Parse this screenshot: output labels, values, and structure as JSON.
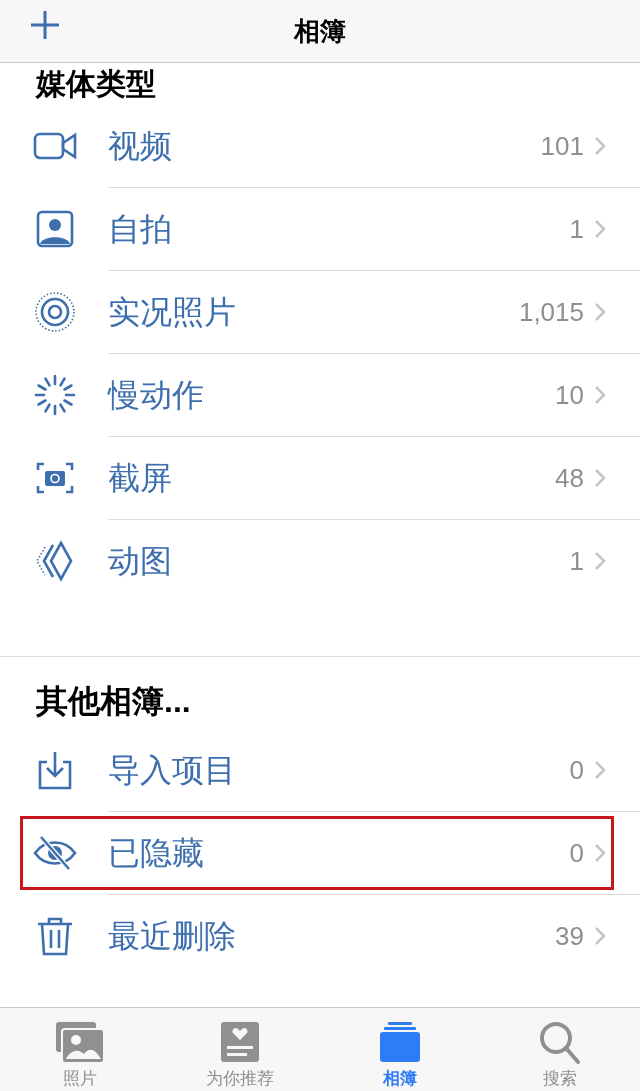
{
  "nav_bar": {
    "title": "相簿"
  },
  "media_types": {
    "title": "媒体类型",
    "items": [
      {
        "kind": "video",
        "label": "视频",
        "count": "101",
        "highlighted": false
      },
      {
        "kind": "selfie",
        "label": "自拍",
        "count": "1",
        "highlighted": false
      },
      {
        "kind": "live",
        "label": "实况照片",
        "count": "1,015",
        "highlighted": false
      },
      {
        "kind": "slomo",
        "label": "慢动作",
        "count": "10",
        "highlighted": false
      },
      {
        "kind": "screenshot",
        "label": "截屏",
        "count": "48",
        "highlighted": false
      },
      {
        "kind": "animated",
        "label": "动图",
        "count": "1",
        "highlighted": false
      }
    ]
  },
  "other_albums": {
    "title": "其他相簿...",
    "items": [
      {
        "kind": "import",
        "label": "导入项目",
        "count": "0",
        "highlighted": false
      },
      {
        "kind": "hidden",
        "label": "已隐藏",
        "count": "0",
        "highlighted": true
      },
      {
        "kind": "trash",
        "label": "最近删除",
        "count": "39",
        "highlighted": false
      }
    ]
  },
  "tab_bar": [
    {
      "kind": "photos",
      "label": "照片",
      "selected": false
    },
    {
      "kind": "foryou",
      "label": "为你推荐",
      "selected": false
    },
    {
      "kind": "albums",
      "label": "相簿",
      "selected": true
    },
    {
      "kind": "search",
      "label": "搜索",
      "selected": false
    }
  ]
}
